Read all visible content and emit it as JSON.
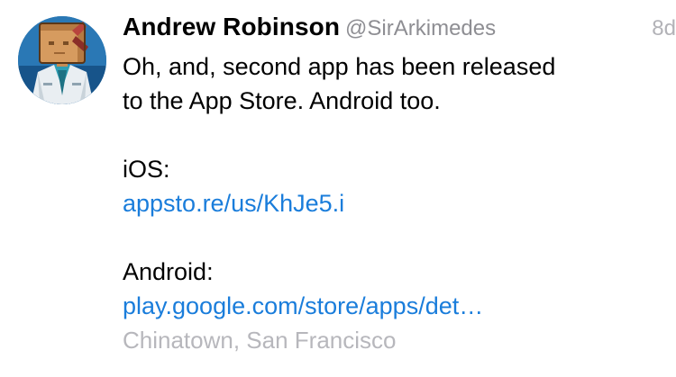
{
  "tweet": {
    "author_name": "Andrew Robinson",
    "handle": "@SirArkimedes",
    "time": "8d",
    "text_line1": "Oh, and, second app has been released",
    "text_line2": "to the App Store. Android too.",
    "ios_label": "iOS:",
    "ios_link": "appsto.re/us/KhJe5.i",
    "android_label": "Android:",
    "android_link": "play.google.com/store/apps/det…",
    "location": "Chinatown, San Francisco"
  },
  "colors": {
    "link": "#1a7ddb",
    "handle": "#8e8e93",
    "location": "#b7b7bc",
    "time": "#b2b2b7"
  },
  "icons": {
    "avatar": "user-avatar-cartoon-character"
  }
}
